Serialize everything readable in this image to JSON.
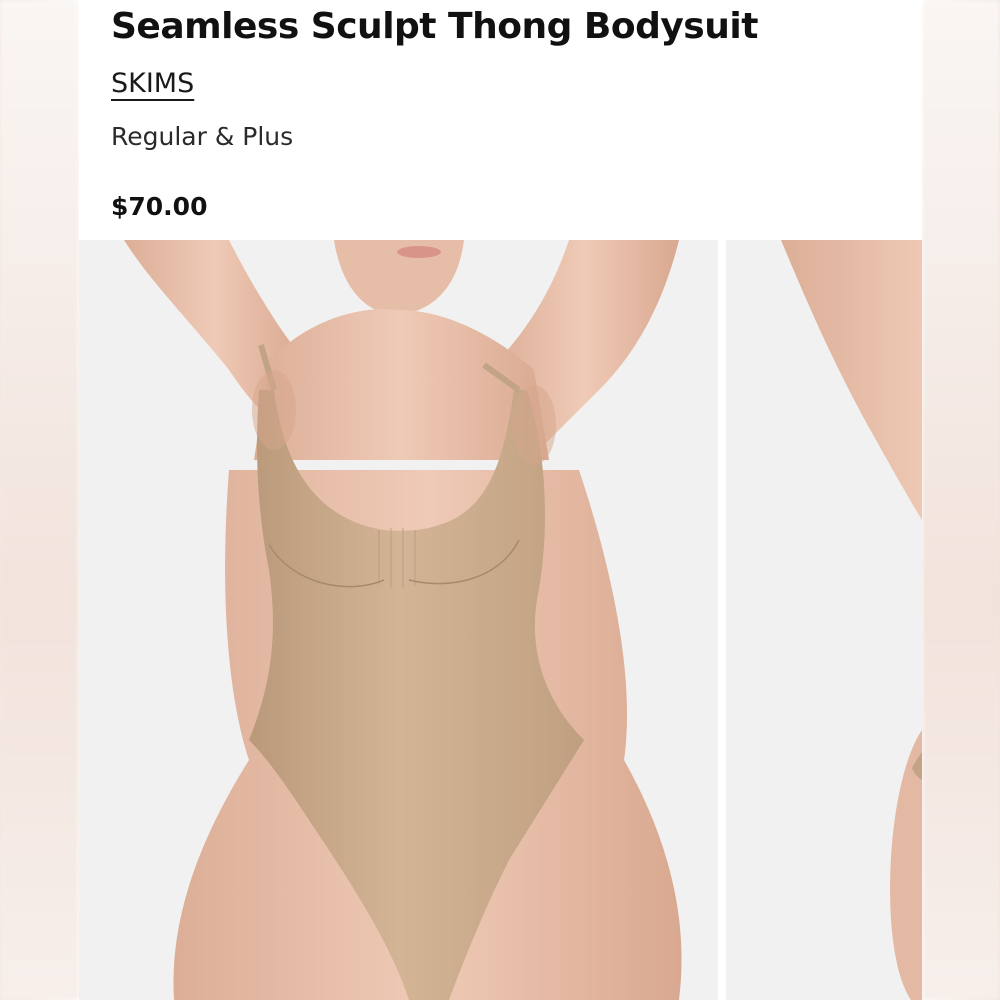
{
  "product": {
    "title": "Seamless Sculpt Thong Bodysuit",
    "brand": "SKIMS",
    "variant": "Regular & Plus",
    "price": "$70.00"
  },
  "gallery": {
    "images": [
      {
        "label": "model-front-view",
        "garment_color": "#c9ab8c",
        "skin_color": "#e9c2ad"
      },
      {
        "label": "model-next-view",
        "garment_color": "#c9ab8c",
        "skin_color": "#e9c2ad"
      }
    ]
  }
}
